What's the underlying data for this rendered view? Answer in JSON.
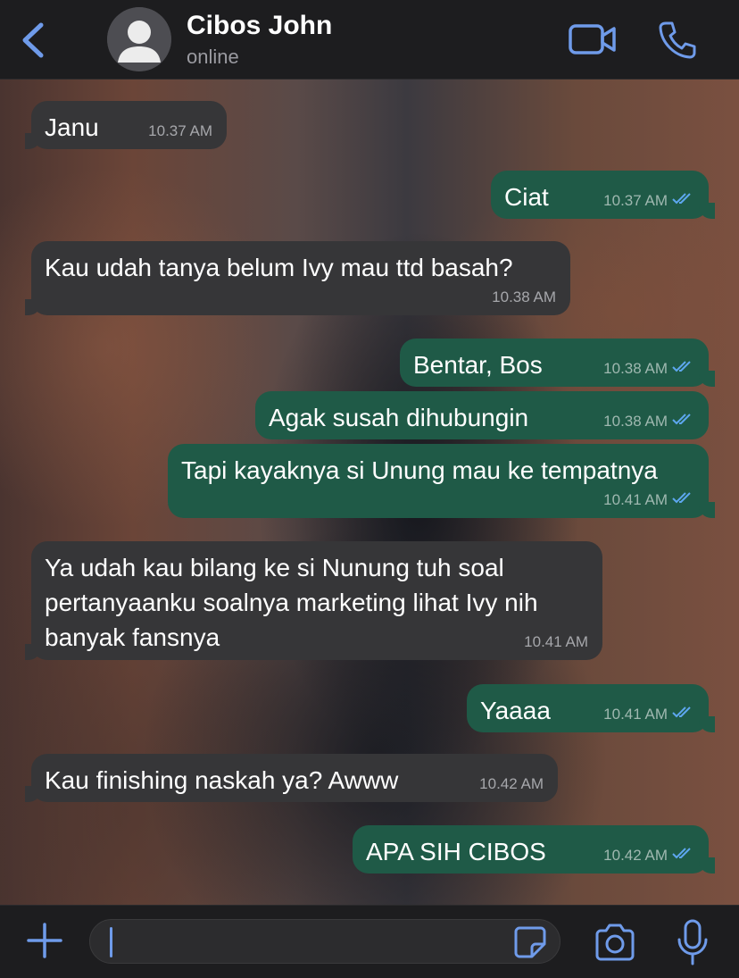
{
  "header": {
    "contact_name": "Cibos John",
    "status": "online"
  },
  "messages": [
    {
      "direction": "incoming",
      "text": "Janu",
      "time": "10.37 AM"
    },
    {
      "direction": "outgoing",
      "text": "Ciat",
      "time": "10.37 AM",
      "read": true
    },
    {
      "direction": "incoming",
      "text": "Kau udah tanya belum Ivy mau ttd basah?",
      "time": "10.38 AM"
    },
    {
      "direction": "outgoing",
      "text": "Bentar, Bos",
      "time": "10.38 AM",
      "read": true
    },
    {
      "direction": "outgoing",
      "text": "Agak susah dihubungin",
      "time": "10.38 AM",
      "read": true
    },
    {
      "direction": "outgoing",
      "text": "Tapi kayaknya si Unung mau ke tempatnya",
      "time": "10.41 AM",
      "read": true
    },
    {
      "direction": "incoming",
      "text": "Ya udah kau bilang ke si Nunung tuh soal\npertanyaanku soalnya marketing lihat Ivy nih\nbanyak fansnya",
      "time": "10.41 AM"
    },
    {
      "direction": "outgoing",
      "text": "Yaaaa",
      "time": "10.41 AM",
      "read": true
    },
    {
      "direction": "incoming",
      "text": "Kau finishing naskah ya? Awww",
      "time": "10.42 AM"
    },
    {
      "direction": "outgoing",
      "text": "APA SIH CIBOS",
      "time": "10.42 AM",
      "read": true
    }
  ],
  "composer": {
    "value": "",
    "placeholder": ""
  },
  "icons": {
    "back": "chevron-left-icon",
    "video": "video-camera-icon",
    "call": "phone-icon",
    "add": "plus-icon",
    "sticker": "sticker-icon",
    "camera": "camera-icon",
    "mic": "microphone-icon",
    "read": "double-check-icon"
  },
  "colors": {
    "accent": "#6f9bea",
    "incoming_bubble": "#363638",
    "outgoing_bubble": "#1f5a47",
    "read_check": "#5ea7f0"
  }
}
